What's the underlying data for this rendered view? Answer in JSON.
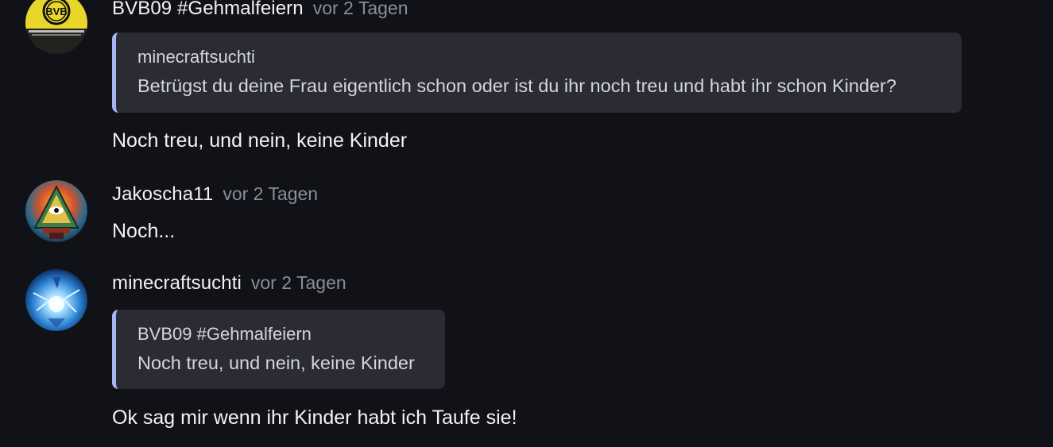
{
  "messages": [
    {
      "author": "BVB09 #Gehmalfeiern",
      "time": "vor 2 Tagen",
      "quote": {
        "author": "minecraftsuchti",
        "text": "Betrügst du deine Frau eigentlich schon oder ist du ihr noch treu und habt ihr schon Kinder?"
      },
      "text": "Noch treu, und nein, keine Kinder",
      "avatar_logo_text": "BVB"
    },
    {
      "author": "Jakoscha11",
      "time": "vor 2 Tagen",
      "text": "Noch..."
    },
    {
      "author": "minecraftsuchti",
      "time": "vor 2 Tagen",
      "quote": {
        "author": "BVB09 #Gehmalfeiern",
        "text": "Noch treu, und nein, keine Kinder"
      },
      "text": "Ok sag mir wenn ihr Kinder habt ich Taufe sie!"
    }
  ],
  "colors": {
    "background": "#111118",
    "quote_background": "#2a2b33",
    "quote_accent": "#a7b6f2",
    "timestamp": "#8b8e96"
  }
}
